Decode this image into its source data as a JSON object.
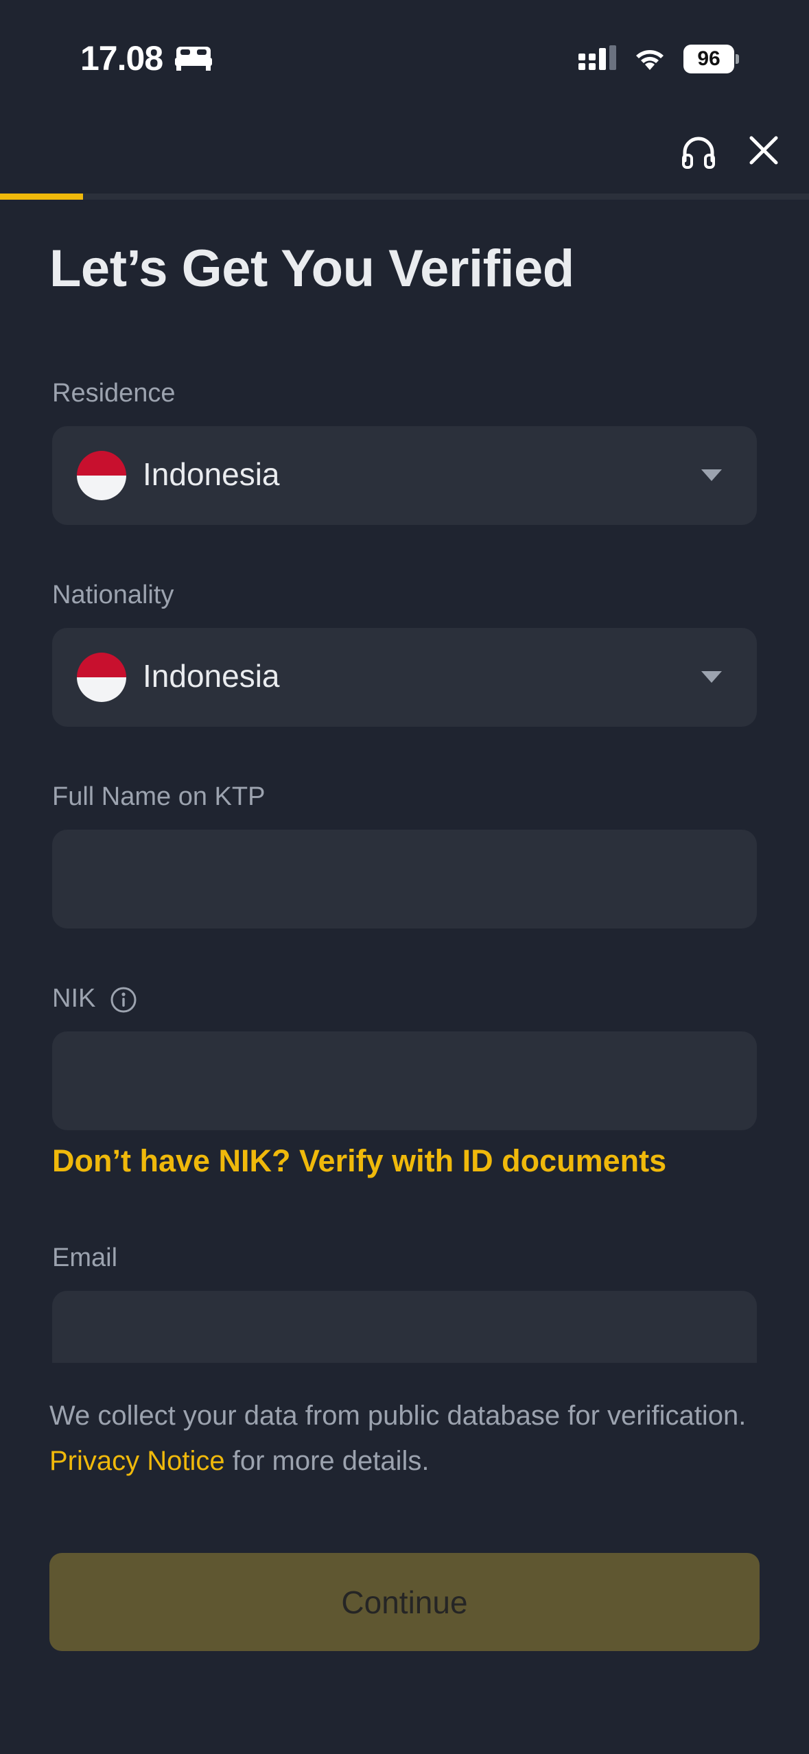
{
  "status_bar": {
    "time": "17.08",
    "battery": "96",
    "icons": [
      "sleep-focus-icon",
      "cellular-signal-icon",
      "wifi-icon",
      "battery-icon"
    ]
  },
  "header": {
    "icons": [
      "headset-support-icon",
      "close-icon"
    ],
    "progress_fraction": 0.103
  },
  "page": {
    "title": "Let’s Get You Verified"
  },
  "form": {
    "residence": {
      "label": "Residence",
      "value": "Indonesia",
      "flag": "indonesia-flag"
    },
    "nationality": {
      "label": "Nationality",
      "value": "Indonesia",
      "flag": "indonesia-flag"
    },
    "full_name": {
      "label": "Full Name on KTP",
      "value": ""
    },
    "nik": {
      "label": "NIK",
      "value": "",
      "info_icon": "info-icon"
    },
    "nik_link": "Don’t have NIK? Verify with ID documents",
    "email": {
      "label": "Email",
      "value": ""
    }
  },
  "footer": {
    "notice_before": "We collect your data from public database for verification. ",
    "notice_link": "Privacy Notice",
    "notice_after": " for more details.",
    "continue_label": "Continue"
  },
  "colors": {
    "background": "#1f2430",
    "field": "#2b303b",
    "accent": "#f0b90b",
    "button_disabled": "#5f5731",
    "label": "#9ca3af"
  }
}
